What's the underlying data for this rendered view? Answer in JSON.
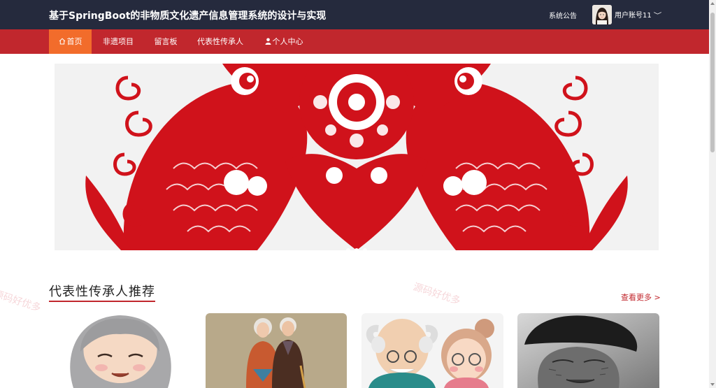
{
  "header": {
    "title": "基于SpringBoot的非物质文化遗产信息管理系统的设计与实现",
    "notice_label": "系统公告",
    "user_label": "用户账号11",
    "user_chevron": "﹀"
  },
  "nav": {
    "items": [
      {
        "label": "首页",
        "icon": "home-icon",
        "active": true
      },
      {
        "label": "非遗项目",
        "active": false
      },
      {
        "label": "留言板",
        "active": false
      },
      {
        "label": "代表性传承人",
        "active": false
      },
      {
        "label": "个人中心",
        "icon": "user-icon",
        "active": false
      }
    ]
  },
  "banner": {
    "slides": 3,
    "active_slide": 2
  },
  "section": {
    "title": "代表性传承人推荐",
    "more_label": "查看更多 >"
  },
  "watermark": {
    "text": "源码好优多"
  },
  "colors": {
    "topbar": "#252a3d",
    "navbar": "#c1272d",
    "nav_active": "#f26c2b",
    "accent": "#c1272d"
  }
}
